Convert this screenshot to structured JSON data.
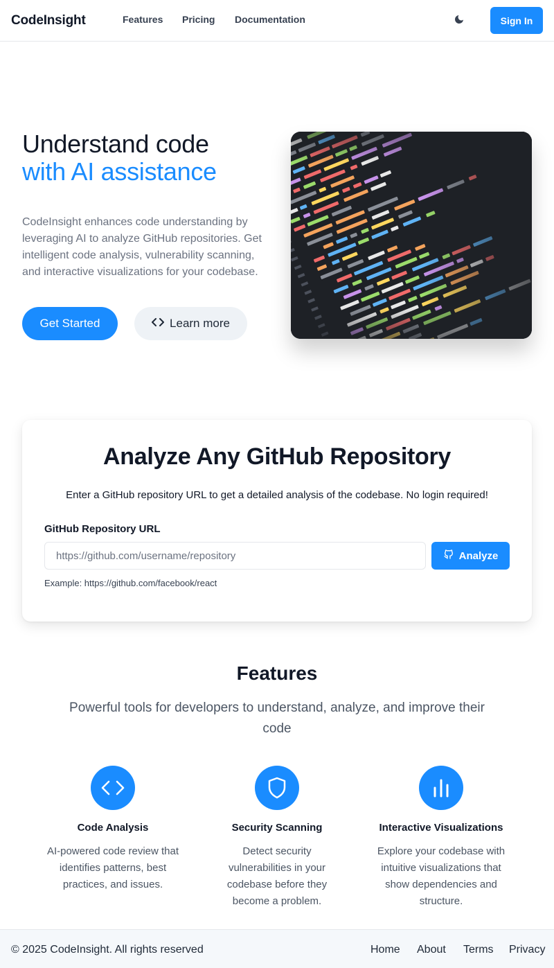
{
  "header": {
    "brand": "CodeInsight",
    "nav": [
      "Features",
      "Pricing",
      "Documentation"
    ],
    "theme_icon": "moon-icon",
    "signin_label": "Sign In"
  },
  "hero": {
    "title_line1": "Understand code",
    "title_line2": "with AI assistance",
    "description": "CodeInsight enhances code understanding by leveraging AI to analyze GitHub repositories. Get intelligent code analysis, vulnerability scanning, and interactive visualizations for your codebase.",
    "primary_label": "Get Started",
    "secondary_label": "Learn more",
    "secondary_icon": "code-icon",
    "image": "code-editor-photo"
  },
  "analyze": {
    "title": "Analyze Any GitHub Repository",
    "subtitle": "Enter a GitHub repository URL to get a detailed analysis of the codebase. No login required!",
    "field_label": "GitHub Repository URL",
    "placeholder": "https://github.com/username/repository",
    "value": "",
    "button_label": "Analyze",
    "button_icon": "github-icon",
    "example": "Example: https://github.com/facebook/react"
  },
  "features": {
    "title": "Features",
    "subtitle": "Powerful tools for developers to understand, analyze, and improve their code",
    "items": [
      {
        "icon": "code-icon",
        "title": "Code Analysis",
        "desc": "AI-powered code review that identifies patterns, best practices, and issues."
      },
      {
        "icon": "shield-icon",
        "title": "Security Scanning",
        "desc": "Detect security vulnerabilities in your codebase before they become a problem."
      },
      {
        "icon": "bar-chart-icon",
        "title": "Interactive Visualizations",
        "desc": "Explore your codebase with intuitive visualizations that show dependencies and structure."
      }
    ]
  },
  "footer": {
    "copyright": "© 2025 CodeInsight. All rights reserved",
    "links": [
      "Home",
      "About",
      "Terms",
      "Privacy"
    ]
  },
  "colors": {
    "accent": "#1a8cff",
    "secondary_button_bg": "#eef2f6",
    "footer_bg": "#f5f8fb"
  }
}
